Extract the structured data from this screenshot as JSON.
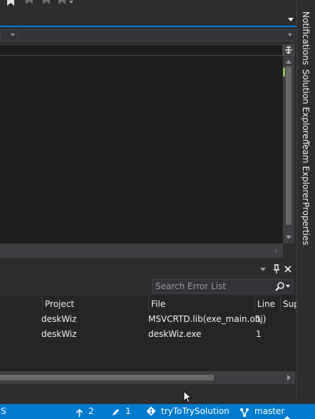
{
  "colors": {
    "status_bar": "#007acc",
    "accent": "#007acc",
    "editor_bg": "#1e1e1e",
    "chrome_bg": "#2d2d30"
  },
  "right_tabs": [
    "Notifications",
    "Solution Explorer",
    "Team Explorer",
    "Properties"
  ],
  "error_list": {
    "search_placeholder": "Search Error List",
    "columns": [
      "Project",
      "File",
      "Line",
      "Sup"
    ],
    "rows": [
      {
        "project": "deskWiz",
        "file": "MSVCRTD.lib(exe_main.obj)",
        "line": "1"
      },
      {
        "project": "deskWiz",
        "file": "deskWiz.exe",
        "line": "1"
      }
    ]
  },
  "status_bar": {
    "left_text": "S",
    "pushes": "2",
    "edits": "1",
    "repo": "tryToTrySolution",
    "branch": "master"
  }
}
